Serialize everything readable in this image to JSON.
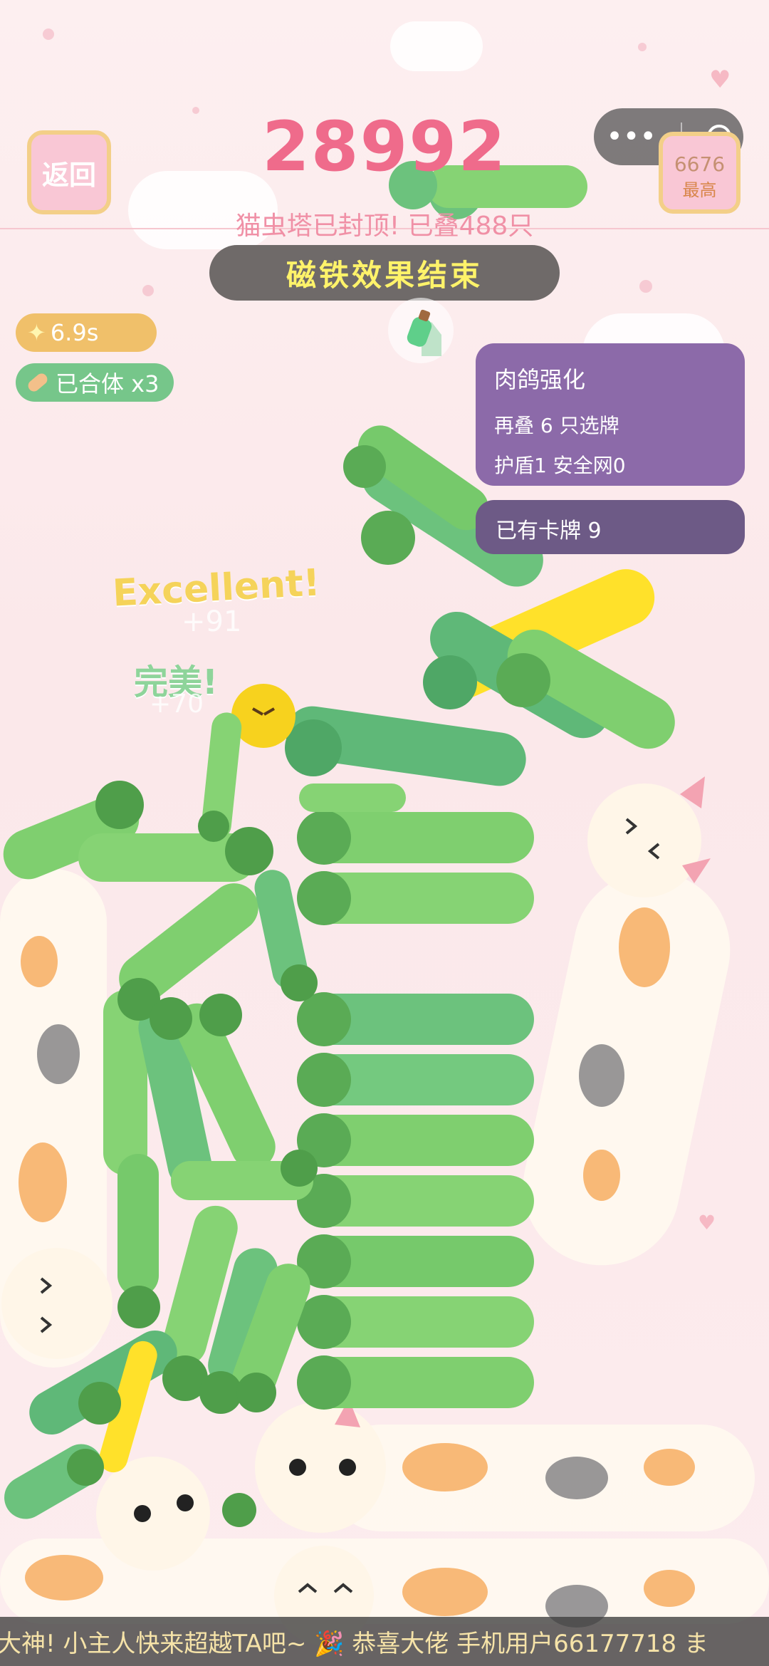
{
  "header": {
    "back_label": "返回",
    "score": "28992",
    "best_value": "6676",
    "best_label": "最高",
    "status": "猫虫塔已封顶! 已叠488只",
    "magnet_banner": "磁铁效果结束"
  },
  "mini_program_capsule": {
    "more_icon": "more-dots-icon",
    "close_icon": "target-close-icon"
  },
  "buffs": {
    "timer": "6.9s",
    "timer_icon": "sparkle-icon",
    "merge": "已合体 x3",
    "merge_icon": "bandage-icon"
  },
  "skill_panel": {
    "title": "肉鸽强化",
    "line1": "再叠 6 只选牌",
    "line2": "护盾1 安全网0"
  },
  "cards_panel": {
    "label": "已有卡牌 9"
  },
  "popups": {
    "excellent": "Excellent!",
    "excellent_points": "+91",
    "perfect": "完美!",
    "perfect_points": "+70"
  },
  "marquee": {
    "text": "大神! 小主人快来超越TA吧~      🎉 恭喜大佬 手机用户66177718 ま"
  },
  "colors": {
    "score": "#ef6b8b",
    "cat_green": "#7fcf6f",
    "cat_dark_green": "#5fb878",
    "cat_yellow": "#ffe12a",
    "panel_purple": "#8c6aa9",
    "background": "#fdeff0"
  }
}
